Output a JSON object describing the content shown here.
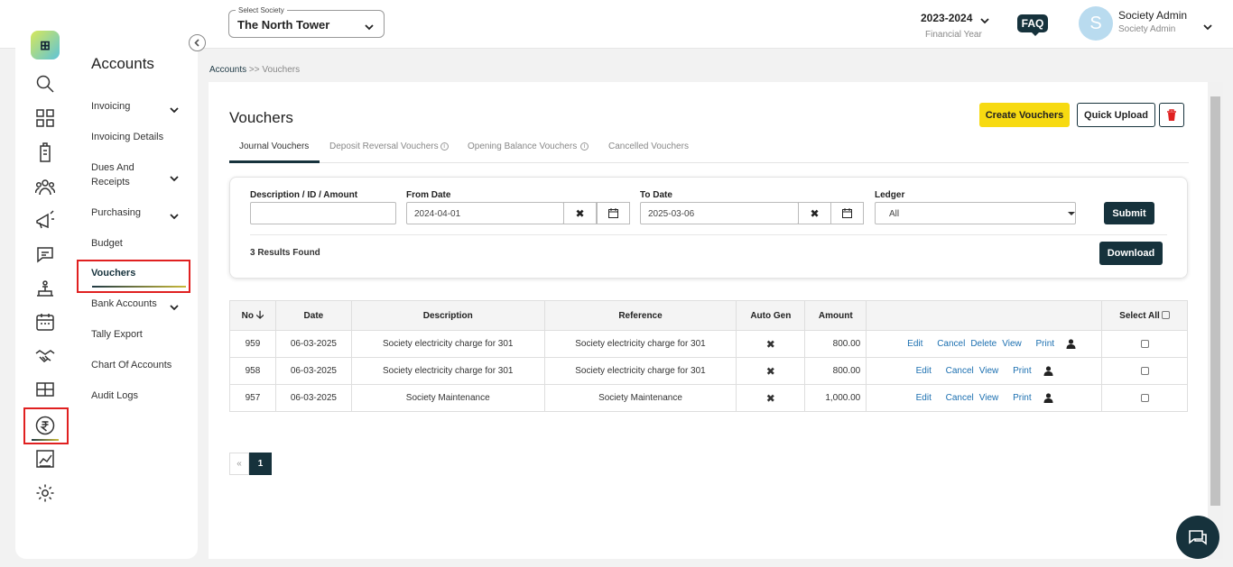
{
  "header": {
    "society_label": "Select Society",
    "society_value": "The North Tower",
    "financial_year": "2023-2024",
    "financial_year_label": "Financial Year",
    "faq": "FAQ",
    "avatar_initial": "S",
    "user_name": "Society Admin",
    "user_role": "Society Admin"
  },
  "sidebar": {
    "title": "Accounts",
    "items": [
      {
        "label": "Invoicing"
      },
      {
        "label": "Invoicing Details"
      },
      {
        "label": "Dues And Receipts"
      },
      {
        "label": "Purchasing"
      },
      {
        "label": "Budget"
      },
      {
        "label": "Vouchers"
      },
      {
        "label": "Bank Accounts"
      },
      {
        "label": "Tally Export"
      },
      {
        "label": "Chart Of Accounts"
      },
      {
        "label": "Audit Logs"
      }
    ]
  },
  "breadcrumb": {
    "root": "Accounts",
    "sep": " >> ",
    "current": "Vouchers"
  },
  "page": {
    "title": "Vouchers",
    "create_button": "Create Vouchers",
    "quick_upload_button": "Quick Upload",
    "tabs": [
      {
        "label": "Journal Vouchers"
      },
      {
        "label": "Deposit Reversal Vouchers"
      },
      {
        "label": "Opening Balance Vouchers"
      },
      {
        "label": "Cancelled Vouchers"
      }
    ]
  },
  "filters": {
    "desc_label": "Description / ID / Amount",
    "desc_value": "",
    "from_label": "From Date",
    "from_value": "2024-04-01",
    "to_label": "To Date",
    "to_value": "2025-03-06",
    "ledger_label": "Ledger",
    "ledger_value": "All",
    "submit": "Submit",
    "results": "3 Results Found",
    "download": "Download"
  },
  "table": {
    "headers": [
      "No",
      "Date",
      "Description",
      "Reference",
      "Auto Gen",
      "Amount",
      "",
      "Select All"
    ],
    "rows": [
      {
        "no": "959",
        "date": "06-03-2025",
        "description": "Society electricity charge for 301",
        "reference": "Society electricity charge for 301",
        "amount": "800.00",
        "actions": [
          "Edit",
          "Cancel",
          "Delete",
          "View",
          "Print"
        ]
      },
      {
        "no": "958",
        "date": "06-03-2025",
        "description": "Society electricity charge for 301",
        "reference": "Society electricity charge for 301",
        "amount": "800.00",
        "actions": [
          "Edit",
          "Cancel",
          "View",
          "Print"
        ]
      },
      {
        "no": "957",
        "date": "06-03-2025",
        "description": "Society Maintenance",
        "reference": "Society Maintenance",
        "amount": "1,000.00",
        "actions": [
          "Edit",
          "Cancel",
          "View",
          "Print"
        ]
      }
    ]
  },
  "pagination": {
    "prev": "«",
    "current": "1"
  }
}
